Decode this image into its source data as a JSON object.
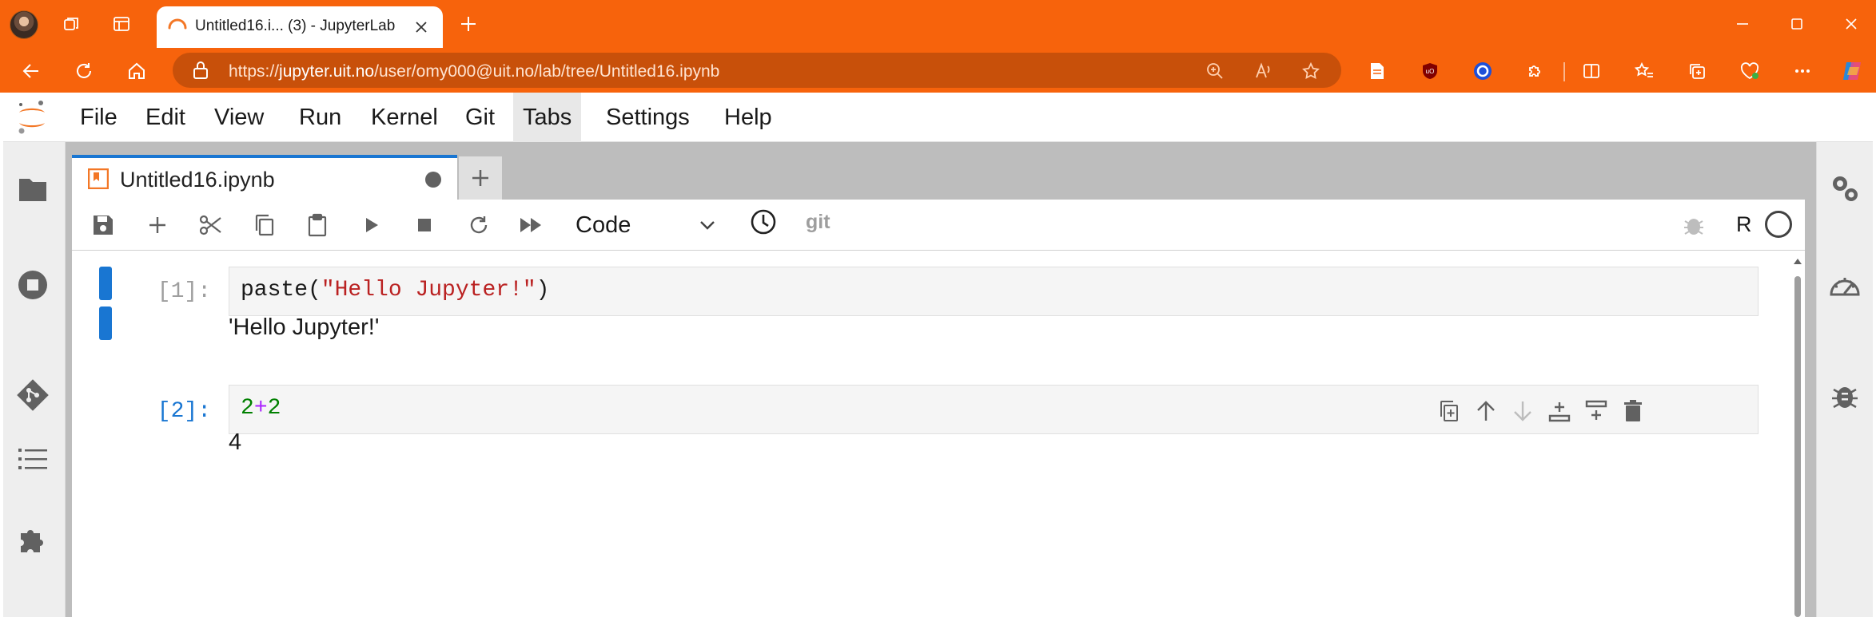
{
  "browser": {
    "tab_title": "Untitled16.i... (3) - JupyterLab",
    "url_prefix": "https://",
    "url_host": "jupyter.uit.no",
    "url_path": "/user/omy000@uit.no/lab/tree/Untitled16.ipynb",
    "accent_color": "#f7630c"
  },
  "menu": {
    "items": [
      {
        "label": "File"
      },
      {
        "label": "Edit"
      },
      {
        "label": "View"
      },
      {
        "label": "Run"
      },
      {
        "label": "Kernel"
      },
      {
        "label": "Git"
      },
      {
        "label": "Tabs"
      },
      {
        "label": "Settings"
      },
      {
        "label": "Help"
      }
    ]
  },
  "notebook": {
    "tab_label": "Untitled16.ipynb",
    "cell_type": "Code",
    "git_label": "git",
    "kernel_name": "R",
    "cells": [
      {
        "prompt": "[1]:",
        "code_fn": "paste(",
        "code_str": "\"Hello Jupyter!\"",
        "code_close": ")",
        "output": "'Hello Jupyter!'"
      },
      {
        "prompt": "[2]:",
        "code_a": "2",
        "code_op": "+",
        "code_b": "2",
        "output": "4"
      }
    ]
  },
  "icons": {
    "left_sidebar": [
      "folder-icon",
      "running-icon",
      "git-icon",
      "toc-icon",
      "extension-icon"
    ],
    "right_sidebar": [
      "property-inspector-icon",
      "kernel-usage-icon",
      "debugger-icon"
    ]
  }
}
